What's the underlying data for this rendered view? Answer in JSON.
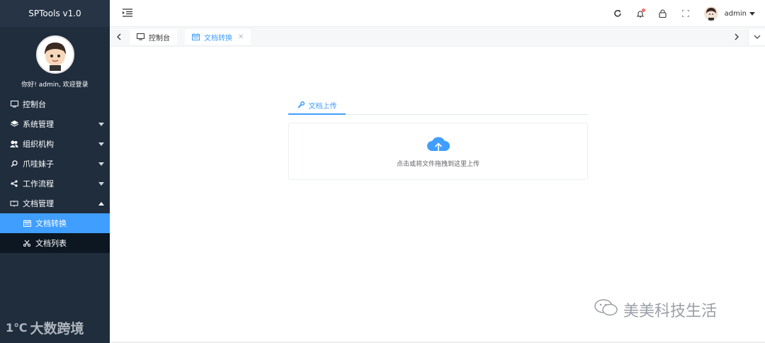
{
  "app": {
    "title": "SPTools v1.0",
    "greeting": "你好!  admin, 欢迎登录"
  },
  "sidebar": {
    "items": [
      {
        "label": "控制台",
        "icon": "monitor-icon"
      },
      {
        "label": "系统管理",
        "icon": "layers-icon"
      },
      {
        "label": "组织机构",
        "icon": "users-icon"
      },
      {
        "label": "爪哇妹子",
        "icon": "search-icon"
      },
      {
        "label": "工作流程",
        "icon": "share-icon"
      },
      {
        "label": "文档管理",
        "icon": "book-icon"
      }
    ],
    "sub_items": [
      {
        "label": "文档转换",
        "icon": "calendar-icon"
      },
      {
        "label": "文档列表",
        "icon": "scissors-icon"
      }
    ],
    "watermark": "大数跨境"
  },
  "header": {
    "user": "admin"
  },
  "tabs": [
    {
      "label": "控制台"
    },
    {
      "label": "文档转换"
    }
  ],
  "main": {
    "upload_tab": "文档上传",
    "dropzone_text": "点击或将文件拖拽到这里上传"
  },
  "watermark": "美美科技生活",
  "colors": {
    "accent": "#409eff",
    "sidebar": "#1f2d3d",
    "sidebar_sub": "#0c1722"
  }
}
